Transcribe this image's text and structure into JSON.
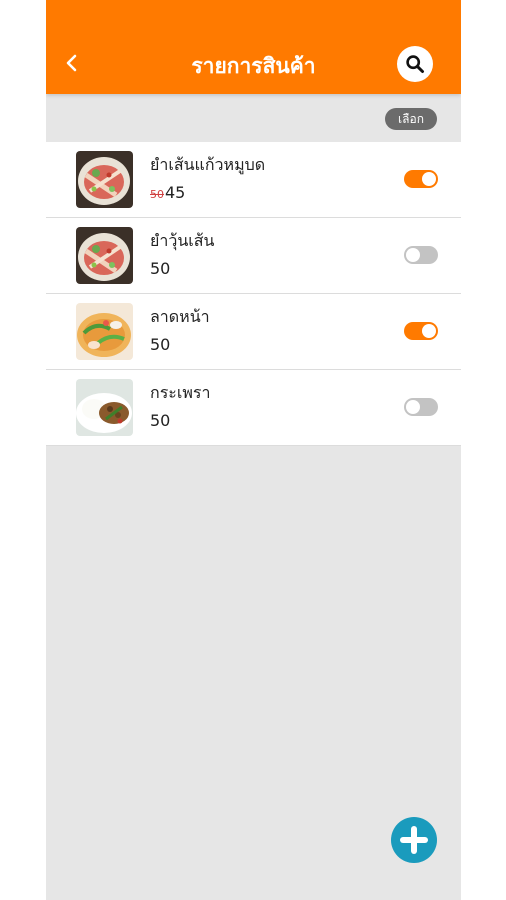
{
  "header": {
    "title": "รายการสินค้า",
    "back_icon": "chevron-left-icon",
    "search_icon": "search-icon",
    "bar_color": "#ff7a00"
  },
  "toolbar": {
    "select_label": "เลือก"
  },
  "products": [
    {
      "name": "ยำเส้นแก้วหมูบด",
      "old_price": "50",
      "price": "45",
      "enabled": true,
      "image": "spicy-salad-image"
    },
    {
      "name": "ยำวุ้นเส้น",
      "old_price": "",
      "price": "50",
      "enabled": false,
      "image": "spicy-salad-image"
    },
    {
      "name": "ลาดหน้า",
      "old_price": "",
      "price": "50",
      "enabled": true,
      "image": "gravy-noodle-image"
    },
    {
      "name": "กระเพรา",
      "old_price": "",
      "price": "50",
      "enabled": false,
      "image": "basil-rice-image"
    }
  ],
  "fab": {
    "icon": "plus-icon",
    "color": "#1a9bbd"
  },
  "colors": {
    "accent": "#ff7a00",
    "toggle_off": "#c3c3c3",
    "background": "#e6e6e6"
  }
}
